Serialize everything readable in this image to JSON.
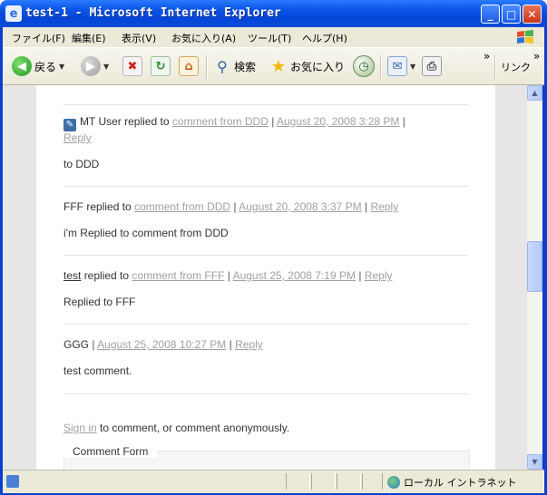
{
  "window": {
    "title": "test-1 - Microsoft Internet Explorer",
    "icon_glyph": "e",
    "controls": {
      "minimize": "_",
      "maximize": "□",
      "close": "✕"
    }
  },
  "menu": {
    "items": [
      "ファイル(F)",
      "編集(E)",
      "表示(V)",
      "お気に入り(A)",
      "ツール(T)",
      "ヘルプ(H)"
    ]
  },
  "toolbar": {
    "back_label": "戻る",
    "search_label": "検索",
    "favorites_label": "お気に入り",
    "links_label": "リンク",
    "more_glyph": "»"
  },
  "comments": [
    {
      "author": "MT User",
      "replied_to": "replied to",
      "target": "comment from DDD",
      "date": "August 20, 2008 3:28 PM",
      "reply": "Reply",
      "body": "to DDD"
    },
    {
      "author": "FFF",
      "replied_to": "replied to",
      "target": "comment from DDD",
      "date": "August 20, 2008 3:37 PM",
      "reply": "Reply",
      "body": "i'm Replied to comment from DDD"
    },
    {
      "author": "test",
      "replied_to": "replied to",
      "target": "comment from FFF",
      "date": "August 25, 2008 7:19 PM",
      "reply": "Reply",
      "body": "Replied to FFF"
    },
    {
      "author": "GGG",
      "date": "August 25, 2008 10:27 PM",
      "reply": "Reply",
      "body": "test comment."
    }
  ],
  "separator": "|",
  "signin": {
    "link": "Sign in",
    "rest": "to comment, or comment anonymously."
  },
  "comment_form": {
    "legend": "Comment Form"
  },
  "status": {
    "zone": "ローカル イントラネット"
  },
  "scrollbar": {
    "position_fraction": 0.45
  }
}
